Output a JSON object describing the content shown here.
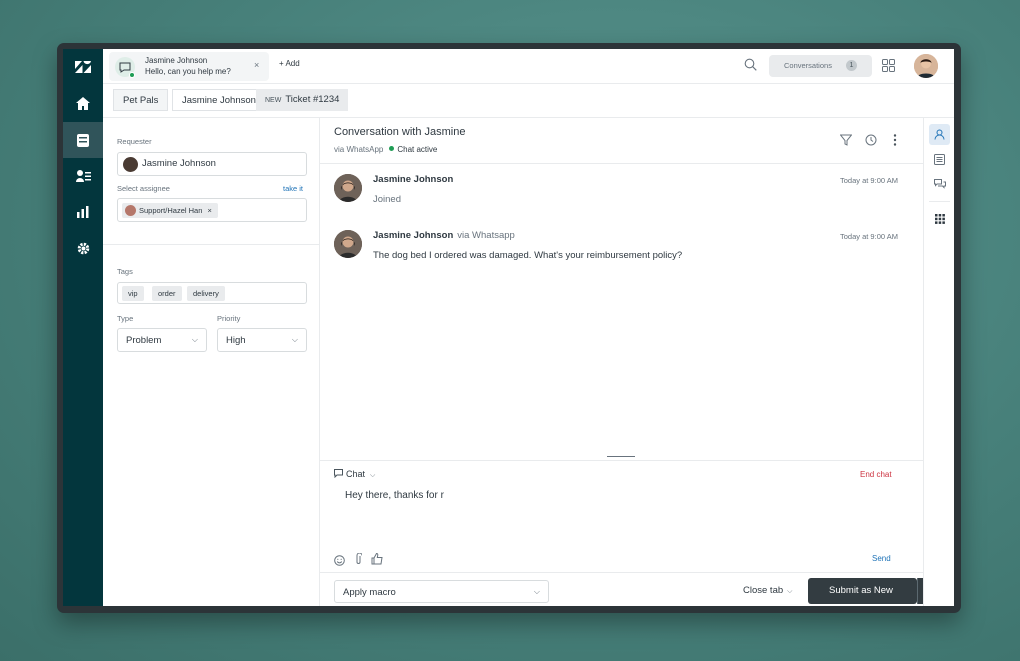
{
  "topbar": {
    "active_tab": {
      "name": "Jasmine Johnson",
      "preview": "Hello, can you help me?",
      "close": "×"
    },
    "add_label": "+ Add",
    "conversations_label": "Conversations",
    "conversations_count": "1"
  },
  "breadcrumb": {
    "org": "Pet Pals",
    "user": "Jasmine Johnson",
    "ticket_badge": "NEW",
    "ticket": "Ticket #1234"
  },
  "left_panel": {
    "requester_label": "Requester",
    "requester_name": "Jasmine Johnson",
    "assignee_label": "Select assignee",
    "take_it": "take it",
    "assignee_chip": "Support/Hazel Han",
    "assignee_chip_remove": "×",
    "tags_label": "Tags",
    "tags": [
      "vip",
      "order",
      "delivery"
    ],
    "type_label": "Type",
    "type_value": "Problem",
    "priority_label": "Priority",
    "priority_value": "High"
  },
  "conversation": {
    "title": "Conversation with Jasmine",
    "channel": "via WhatsApp",
    "status": "Chat active",
    "messages": [
      {
        "author": "Jasmine Johnson",
        "via": "",
        "time": "Today at 9:00 AM",
        "text": "Joined"
      },
      {
        "author": "Jasmine Johnson",
        "via": "via Whatsapp",
        "time": "Today at 9:00 AM",
        "text": "The dog bed I ordered was damaged. What's your reimbursement policy?"
      }
    ]
  },
  "composer": {
    "channel_label": "Chat",
    "end_chat": "End chat",
    "draft": "Hey there, thanks for r",
    "send": "Send"
  },
  "bottombar": {
    "macro_placeholder": "Apply macro",
    "close_tab": "Close tab",
    "submit_prefix": "Submit as",
    "submit_status": "New"
  },
  "colors": {
    "nav_bg": "#03363d",
    "status_green": "#1f9d55",
    "end_chat_red": "#cc3340",
    "link_blue": "#1f73b7",
    "submit_bg": "#333c41"
  }
}
